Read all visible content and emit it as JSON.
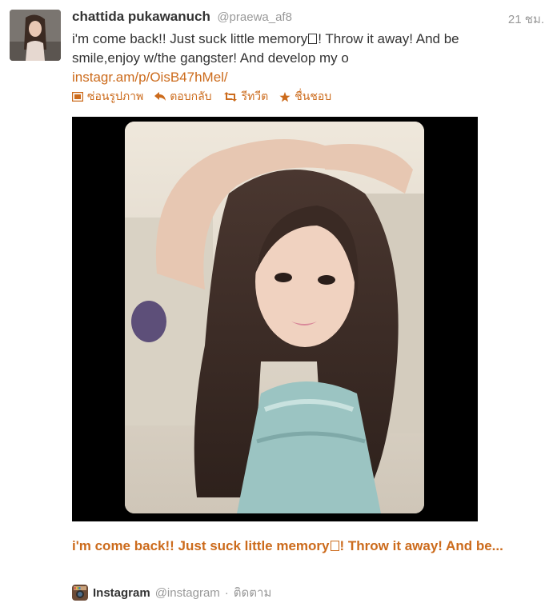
{
  "tweet": {
    "fullname": "chattida pukawanuch",
    "username": "@praewa_af8",
    "time": "21 ชม.",
    "text_part1": "i'm come back!! Just suck little memory",
    "text_part2": "! Throw it away! And be smile,enjoy w/the gangster! And develop my o",
    "link": "instagr.am/p/OisB47hMel/"
  },
  "actions": {
    "hide_photo": "ซ่อนรูปภาพ",
    "reply": "ตอบกลับ",
    "retweet": "รีทวีต",
    "favorite": "ชื่นชอบ"
  },
  "card": {
    "title_part1": "i'm come back!! Just suck little memory",
    "title_part2": "! Throw it away! And be..."
  },
  "attribution": {
    "name": "Instagram",
    "handle": "@instagram",
    "separator": "·",
    "follow": "ติดตาม"
  },
  "icons": {
    "hide_photo": "photo-icon",
    "reply": "reply-arrow-icon",
    "retweet": "retweet-icon",
    "favorite": "star-icon",
    "instagram": "instagram-camera-icon"
  },
  "colors": {
    "link": "#cc6b1c",
    "text": "#333333",
    "muted": "#999999",
    "media_background": "#000000"
  }
}
